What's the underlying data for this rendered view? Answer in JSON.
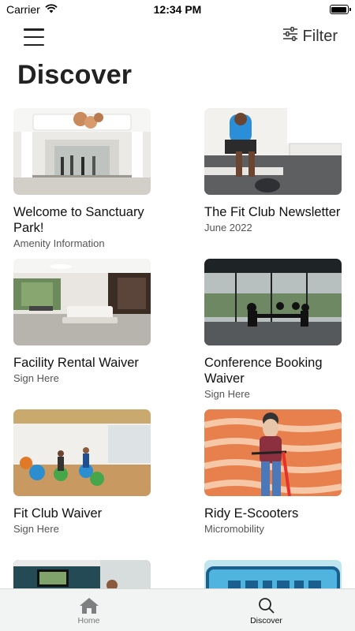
{
  "status": {
    "carrier": "Carrier",
    "time": "12:34 PM"
  },
  "header": {
    "filter_label": "Filter",
    "title": "Discover"
  },
  "cards": [
    {
      "title": "Welcome to Sanctuary Park!",
      "subtitle": "Amenity Information"
    },
    {
      "title": "The Fit Club Newsletter",
      "subtitle": "June 2022"
    },
    {
      "title": "Facility Rental Waiver",
      "subtitle": "Sign Here"
    },
    {
      "title": "Conference Booking Waiver",
      "subtitle": "Sign Here"
    },
    {
      "title": "Fit Club Waiver",
      "subtitle": "Sign Here"
    },
    {
      "title": "Ridy E-Scooters",
      "subtitle": "Micromobility"
    }
  ],
  "tabs": {
    "home": "Home",
    "discover": "Discover"
  },
  "icons": [
    "wifi-icon",
    "battery-icon",
    "menu-icon",
    "sliders-icon",
    "home-icon",
    "search-icon"
  ]
}
